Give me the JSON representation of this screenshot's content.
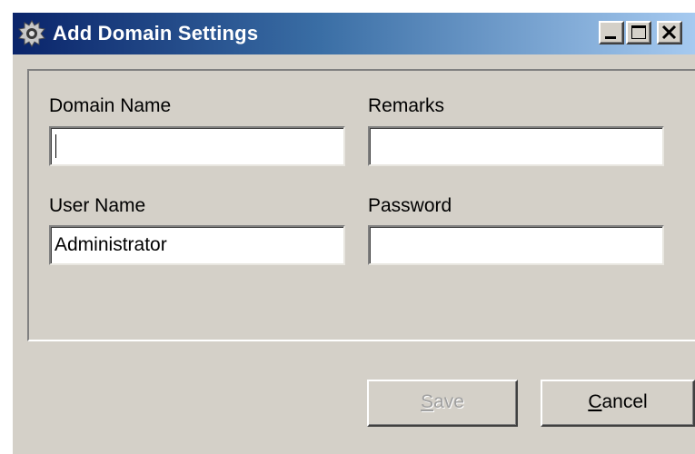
{
  "window": {
    "title": "Add Domain Settings",
    "icon": "gear-icon",
    "controls": [
      "minimize-icon",
      "maximize-icon",
      "close-icon"
    ]
  },
  "form": {
    "domain_name": {
      "label": "Domain Name",
      "value": ""
    },
    "remarks": {
      "label": "Remarks",
      "value": ""
    },
    "user_name": {
      "label": "User Name",
      "value": "Administrator"
    },
    "password": {
      "label": "Password",
      "value": ""
    }
  },
  "buttons": {
    "save": {
      "mnemonic": "S",
      "rest": "ave",
      "enabled": false
    },
    "cancel": {
      "mnemonic": "C",
      "rest": "ancel",
      "enabled": true
    }
  },
  "colors": {
    "titlebar_start": "#0a246a",
    "titlebar_end": "#a6caf0",
    "face": "#d4d0c8"
  }
}
